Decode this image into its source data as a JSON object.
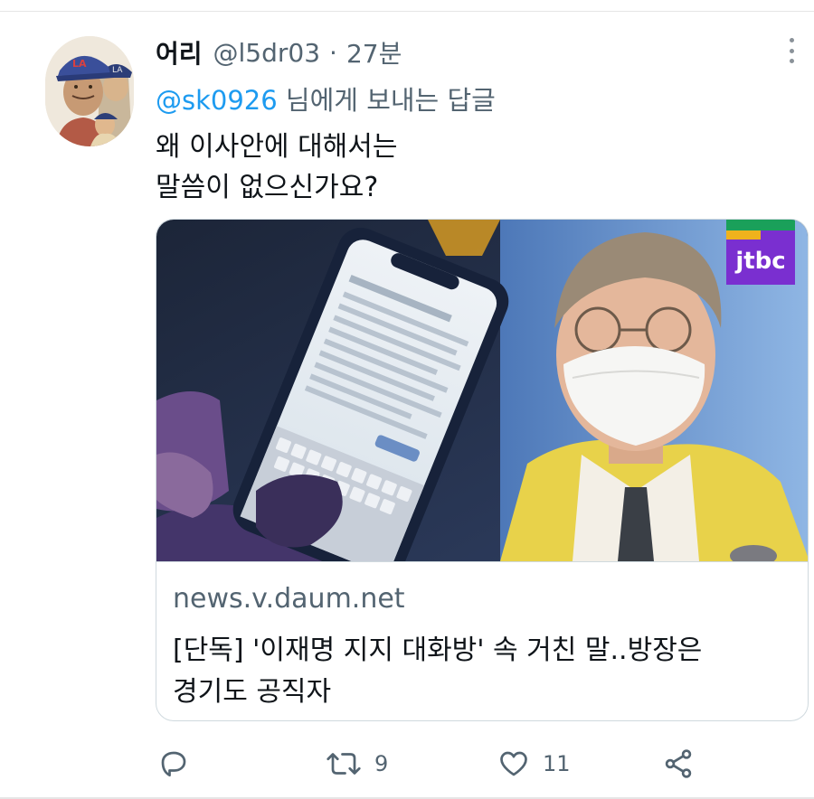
{
  "tweet": {
    "display_name": "어리",
    "handle": "@l5dr03",
    "separator": "·",
    "time": "27분",
    "reply_to": {
      "mention": "@sk0926",
      "suffix": " 님에게 보내는 답글"
    },
    "text_lines": [
      "왜 이사안에 대해서는",
      "말씀이 없으신가요?"
    ]
  },
  "card": {
    "image_badge": "jtbc",
    "domain": "news.v.daum.net",
    "title_lines": [
      "[단독] '이재명 지지 대화방' 속 거친 말..방장은",
      "경기도 공직자"
    ]
  },
  "actions": {
    "reply_icon": "reply-icon",
    "retweet_icon": "retweet-icon",
    "retweet_count": "9",
    "like_icon": "heart-icon",
    "like_count": "11",
    "share_icon": "share-icon"
  },
  "colors": {
    "link": "#1d9bf0",
    "secondary_text": "#536471",
    "border": "#cfd9de",
    "jtbc_badge": "#7a2fd0"
  }
}
